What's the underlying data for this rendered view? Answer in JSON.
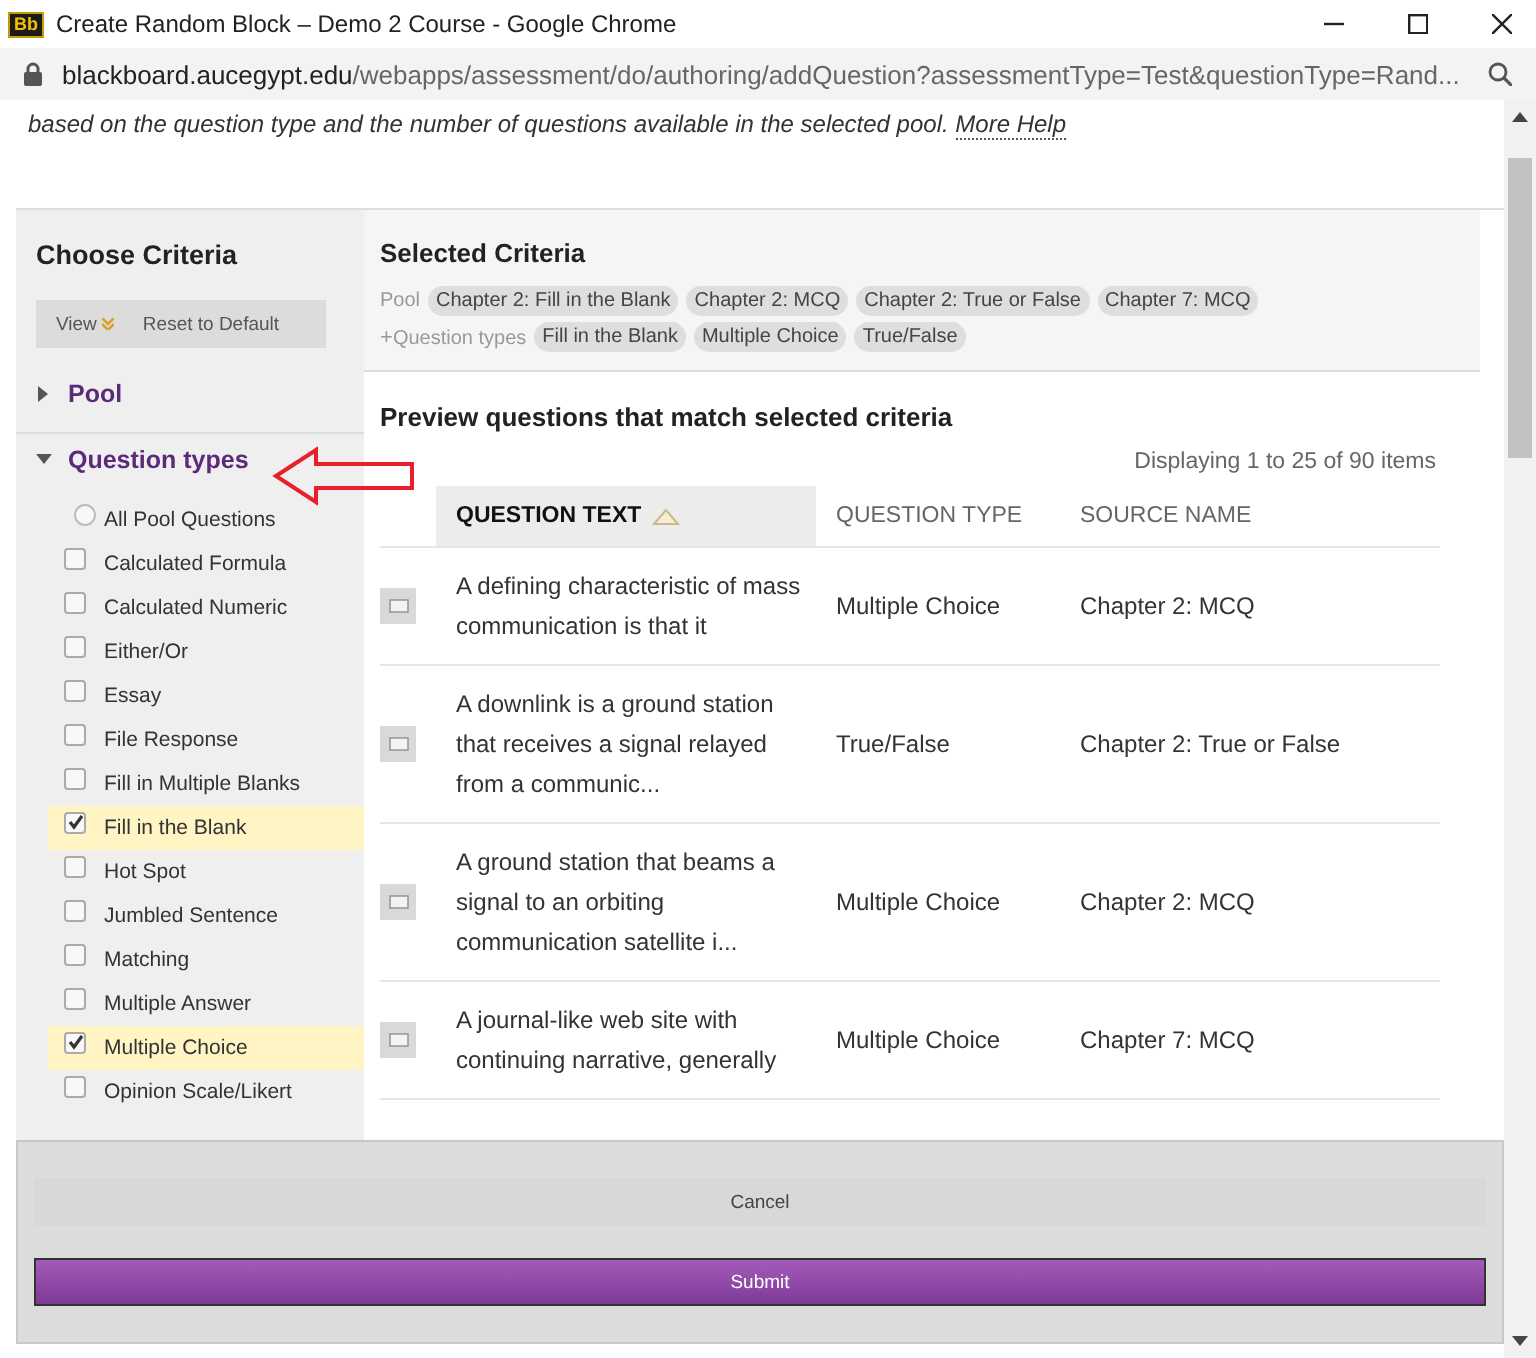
{
  "window": {
    "app_icon": "Bb",
    "title": "Create Random Block – Demo 2 Course - Google Chrome"
  },
  "address_bar": {
    "domain": "blackboard.aucegypt.edu",
    "path": "/webapps/assessment/do/authoring/addQuestion?assessmentType=Test&questionType=Rand..."
  },
  "intro": {
    "text": "based on the question type and the number of questions available in the selected pool.",
    "link": "More Help"
  },
  "sidebar": {
    "title": "Choose Criteria",
    "buttons": [
      {
        "label": "View",
        "kind": "menu"
      },
      {
        "label": "Reset to Default",
        "kind": "plain"
      }
    ],
    "sections": [
      {
        "label": "Pool",
        "expanded": false
      },
      {
        "label": "Question types",
        "expanded": true,
        "options": [
          {
            "label": "All Pool Questions",
            "kind": "radio",
            "checked": false
          },
          {
            "label": "Calculated Formula",
            "kind": "checkbox",
            "checked": false
          },
          {
            "label": "Calculated Numeric",
            "kind": "checkbox",
            "checked": false
          },
          {
            "label": "Either/Or",
            "kind": "checkbox",
            "checked": false
          },
          {
            "label": "Essay",
            "kind": "checkbox",
            "checked": false
          },
          {
            "label": "File Response",
            "kind": "checkbox",
            "checked": false
          },
          {
            "label": "Fill in Multiple Blanks",
            "kind": "checkbox",
            "checked": false
          },
          {
            "label": "Fill in the Blank",
            "kind": "checkbox",
            "checked": true
          },
          {
            "label": "Hot Spot",
            "kind": "checkbox",
            "checked": false
          },
          {
            "label": "Jumbled Sentence",
            "kind": "checkbox",
            "checked": false
          },
          {
            "label": "Matching",
            "kind": "checkbox",
            "checked": false
          },
          {
            "label": "Multiple Answer",
            "kind": "checkbox",
            "checked": false
          },
          {
            "label": "Multiple Choice",
            "kind": "checkbox",
            "checked": true
          },
          {
            "label": "Opinion Scale/Likert",
            "kind": "checkbox",
            "checked": false
          }
        ]
      }
    ]
  },
  "selected_criteria": {
    "title": "Selected Criteria",
    "groups": [
      {
        "label": "Pool",
        "tags": [
          "Chapter 2: Fill in the Blank",
          "Chapter 2: MCQ",
          "Chapter 2: True or False",
          "Chapter 7: MCQ"
        ]
      },
      {
        "prefix": "+",
        "label": "Question types",
        "tags": [
          "Fill in the Blank",
          "Multiple Choice",
          "True/False"
        ]
      }
    ]
  },
  "preview": {
    "title": "Preview questions that match selected criteria",
    "count": "Displaying 1 to 25 of 90 items",
    "columns": [
      {
        "label": "QUESTION TEXT",
        "sorted": true
      },
      {
        "label": "QUESTION TYPE",
        "sorted": false
      },
      {
        "label": "SOURCE NAME",
        "sorted": false
      }
    ],
    "rows": [
      {
        "question_text": "A defining characteristic of mass communication is that it",
        "question_type": "Multiple Choice",
        "source_name": "Chapter 2: MCQ"
      },
      {
        "question_text": "A downlink is a ground station that receives a signal relayed from a communic...",
        "question_type": "True/False",
        "source_name": "Chapter 2: True or False"
      },
      {
        "question_text": "A ground station that beams a signal to an orbiting communication satellite i...",
        "question_type": "Multiple Choice",
        "source_name": "Chapter 2: MCQ"
      },
      {
        "question_text": "A journal-like web site with continuing narrative, generally",
        "question_type": "Multiple Choice",
        "source_name": "Chapter 7: MCQ"
      }
    ]
  },
  "footer": {
    "buttons": [
      {
        "label": "Cancel",
        "kind": "secondary"
      },
      {
        "label": "Submit",
        "kind": "primary"
      }
    ]
  }
}
